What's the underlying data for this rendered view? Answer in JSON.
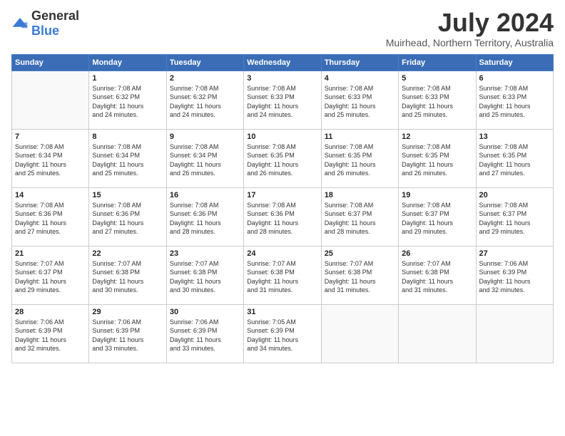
{
  "logo": {
    "general": "General",
    "blue": "Blue"
  },
  "title": {
    "month_year": "July 2024",
    "location": "Muirhead, Northern Territory, Australia"
  },
  "columns": [
    "Sunday",
    "Monday",
    "Tuesday",
    "Wednesday",
    "Thursday",
    "Friday",
    "Saturday"
  ],
  "weeks": [
    [
      {
        "day": "",
        "info": ""
      },
      {
        "day": "1",
        "info": "Sunrise: 7:08 AM\nSunset: 6:32 PM\nDaylight: 11 hours\nand 24 minutes."
      },
      {
        "day": "2",
        "info": "Sunrise: 7:08 AM\nSunset: 6:32 PM\nDaylight: 11 hours\nand 24 minutes."
      },
      {
        "day": "3",
        "info": "Sunrise: 7:08 AM\nSunset: 6:33 PM\nDaylight: 11 hours\nand 24 minutes."
      },
      {
        "day": "4",
        "info": "Sunrise: 7:08 AM\nSunset: 6:33 PM\nDaylight: 11 hours\nand 25 minutes."
      },
      {
        "day": "5",
        "info": "Sunrise: 7:08 AM\nSunset: 6:33 PM\nDaylight: 11 hours\nand 25 minutes."
      },
      {
        "day": "6",
        "info": "Sunrise: 7:08 AM\nSunset: 6:33 PM\nDaylight: 11 hours\nand 25 minutes."
      }
    ],
    [
      {
        "day": "7",
        "info": "Sunrise: 7:08 AM\nSunset: 6:34 PM\nDaylight: 11 hours\nand 25 minutes."
      },
      {
        "day": "8",
        "info": "Sunrise: 7:08 AM\nSunset: 6:34 PM\nDaylight: 11 hours\nand 25 minutes."
      },
      {
        "day": "9",
        "info": "Sunrise: 7:08 AM\nSunset: 6:34 PM\nDaylight: 11 hours\nand 26 minutes."
      },
      {
        "day": "10",
        "info": "Sunrise: 7:08 AM\nSunset: 6:35 PM\nDaylight: 11 hours\nand 26 minutes."
      },
      {
        "day": "11",
        "info": "Sunrise: 7:08 AM\nSunset: 6:35 PM\nDaylight: 11 hours\nand 26 minutes."
      },
      {
        "day": "12",
        "info": "Sunrise: 7:08 AM\nSunset: 6:35 PM\nDaylight: 11 hours\nand 26 minutes."
      },
      {
        "day": "13",
        "info": "Sunrise: 7:08 AM\nSunset: 6:35 PM\nDaylight: 11 hours\nand 27 minutes."
      }
    ],
    [
      {
        "day": "14",
        "info": "Sunrise: 7:08 AM\nSunset: 6:36 PM\nDaylight: 11 hours\nand 27 minutes."
      },
      {
        "day": "15",
        "info": "Sunrise: 7:08 AM\nSunset: 6:36 PM\nDaylight: 11 hours\nand 27 minutes."
      },
      {
        "day": "16",
        "info": "Sunrise: 7:08 AM\nSunset: 6:36 PM\nDaylight: 11 hours\nand 28 minutes."
      },
      {
        "day": "17",
        "info": "Sunrise: 7:08 AM\nSunset: 6:36 PM\nDaylight: 11 hours\nand 28 minutes."
      },
      {
        "day": "18",
        "info": "Sunrise: 7:08 AM\nSunset: 6:37 PM\nDaylight: 11 hours\nand 28 minutes."
      },
      {
        "day": "19",
        "info": "Sunrise: 7:08 AM\nSunset: 6:37 PM\nDaylight: 11 hours\nand 29 minutes."
      },
      {
        "day": "20",
        "info": "Sunrise: 7:08 AM\nSunset: 6:37 PM\nDaylight: 11 hours\nand 29 minutes."
      }
    ],
    [
      {
        "day": "21",
        "info": "Sunrise: 7:07 AM\nSunset: 6:37 PM\nDaylight: 11 hours\nand 29 minutes."
      },
      {
        "day": "22",
        "info": "Sunrise: 7:07 AM\nSunset: 6:38 PM\nDaylight: 11 hours\nand 30 minutes."
      },
      {
        "day": "23",
        "info": "Sunrise: 7:07 AM\nSunset: 6:38 PM\nDaylight: 11 hours\nand 30 minutes."
      },
      {
        "day": "24",
        "info": "Sunrise: 7:07 AM\nSunset: 6:38 PM\nDaylight: 11 hours\nand 31 minutes."
      },
      {
        "day": "25",
        "info": "Sunrise: 7:07 AM\nSunset: 6:38 PM\nDaylight: 11 hours\nand 31 minutes."
      },
      {
        "day": "26",
        "info": "Sunrise: 7:07 AM\nSunset: 6:38 PM\nDaylight: 11 hours\nand 31 minutes."
      },
      {
        "day": "27",
        "info": "Sunrise: 7:06 AM\nSunset: 6:39 PM\nDaylight: 11 hours\nand 32 minutes."
      }
    ],
    [
      {
        "day": "28",
        "info": "Sunrise: 7:06 AM\nSunset: 6:39 PM\nDaylight: 11 hours\nand 32 minutes."
      },
      {
        "day": "29",
        "info": "Sunrise: 7:06 AM\nSunset: 6:39 PM\nDaylight: 11 hours\nand 33 minutes."
      },
      {
        "day": "30",
        "info": "Sunrise: 7:06 AM\nSunset: 6:39 PM\nDaylight: 11 hours\nand 33 minutes."
      },
      {
        "day": "31",
        "info": "Sunrise: 7:05 AM\nSunset: 6:39 PM\nDaylight: 11 hours\nand 34 minutes."
      },
      {
        "day": "",
        "info": ""
      },
      {
        "day": "",
        "info": ""
      },
      {
        "day": "",
        "info": ""
      }
    ]
  ]
}
